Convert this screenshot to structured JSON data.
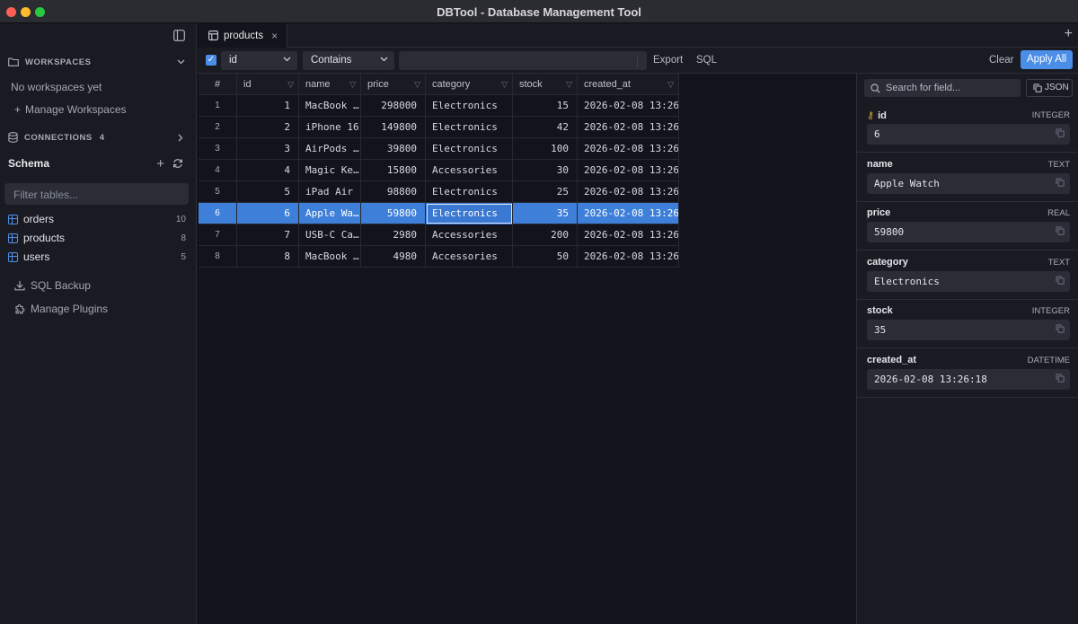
{
  "window": {
    "title": "DBTool - Database Management Tool"
  },
  "sidebar": {
    "workspaces_label": "WORKSPACES",
    "no_workspaces": "No workspaces yet",
    "manage_workspaces": "Manage Workspaces",
    "connections_label": "CONNECTIONS",
    "connections_count": "4",
    "schema_label": "Schema",
    "filter_placeholder": "Filter tables...",
    "tables": [
      {
        "name": "orders",
        "count": "10"
      },
      {
        "name": "products",
        "count": "8"
      },
      {
        "name": "users",
        "count": "5"
      }
    ],
    "sql_backup": "SQL Backup",
    "manage_plugins": "Manage Plugins"
  },
  "tabs": {
    "active": "products",
    "close": "×",
    "add": "+"
  },
  "filter": {
    "column": "id",
    "operator": "Contains",
    "value": "",
    "export": "Export",
    "sql": "SQL",
    "clear": "Clear",
    "apply_all": "Apply All"
  },
  "grid": {
    "columns": [
      "#",
      "id",
      "name",
      "price",
      "category",
      "stock",
      "created_at"
    ],
    "rows": [
      [
        "1",
        "1",
        "MacBook …",
        "298000",
        "Electronics",
        "15",
        "2026-02-08 13:26…"
      ],
      [
        "2",
        "2",
        "iPhone 16",
        "149800",
        "Electronics",
        "42",
        "2026-02-08 13:26…"
      ],
      [
        "3",
        "3",
        "AirPods …",
        "39800",
        "Electronics",
        "100",
        "2026-02-08 13:26…"
      ],
      [
        "4",
        "4",
        "Magic Ke…",
        "15800",
        "Accessories",
        "30",
        "2026-02-08 13:26…"
      ],
      [
        "5",
        "5",
        "iPad Air",
        "98800",
        "Electronics",
        "25",
        "2026-02-08 13:26…"
      ],
      [
        "6",
        "6",
        "Apple Wa…",
        "59800",
        "Electronics",
        "35",
        "2026-02-08 13:26…"
      ],
      [
        "7",
        "7",
        "USB-C Ca…",
        "2980",
        "Accessories",
        "200",
        "2026-02-08 13:26…"
      ],
      [
        "8",
        "8",
        "MacBook …",
        "4980",
        "Accessories",
        "50",
        "2026-02-08 13:26…"
      ]
    ],
    "selected_row": 6
  },
  "detail": {
    "search_placeholder": "Search for field...",
    "json_button": "JSON",
    "fields": [
      {
        "name": "id",
        "type": "INTEGER",
        "value": "6"
      },
      {
        "name": "name",
        "type": "TEXT",
        "value": "Apple Watch"
      },
      {
        "name": "price",
        "type": "REAL",
        "value": "59800"
      },
      {
        "name": "category",
        "type": "TEXT",
        "value": "Electronics"
      },
      {
        "name": "stock",
        "type": "INTEGER",
        "value": "35"
      },
      {
        "name": "created_at",
        "type": "DATETIME",
        "value": "2026-02-08 13:26:18"
      }
    ]
  },
  "colors": {
    "accent": "#4a8ee8",
    "selected_row": "#3e7fd9",
    "background": "#13141b",
    "panel": "#1a1b22"
  }
}
